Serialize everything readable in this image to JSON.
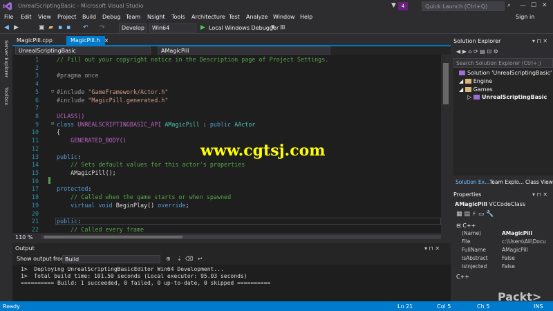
{
  "window": {
    "title": "UnrealScriptingBasic - Microsoft Visual Studio",
    "notification_count": "4",
    "quick_launch_placeholder": "Quick Launch (Ctrl+Q)",
    "sign_in": "Sign in"
  },
  "menu": [
    "File",
    "Edit",
    "View",
    "Project",
    "Build",
    "Debug",
    "Team",
    "Nsight",
    "Tools",
    "Architecture",
    "Test",
    "Analyze",
    "Window",
    "Help"
  ],
  "toolbar": {
    "config": "Develop",
    "platform": "Win64",
    "debugger": "Local Windows Debugger"
  },
  "side_tabs": [
    "Server Explorer",
    "Toolbox"
  ],
  "tabs": [
    {
      "label": "MagicPill.cpp"
    },
    {
      "label": "MagicPill.h",
      "close": "×"
    }
  ],
  "nav": {
    "project": "UnrealScriptingBasic",
    "symbol": "AMagicPill"
  },
  "editor": {
    "line_numbers": [
      "1",
      "2",
      "3",
      "4",
      "5",
      "6",
      "7",
      "8",
      "9",
      "10",
      "11",
      "12",
      "13",
      "14",
      "15",
      "16",
      "17",
      "18",
      "19",
      "20",
      "21",
      "22"
    ],
    "lines": {
      "l1": "// Fill out your copyright notice in the Description page of Project Settings.",
      "l3": "#pragma once",
      "l5a": "#include ",
      "l5b": "\"GameFramework/Actor.h\"",
      "l6a": "#include ",
      "l6b": "\"MagicPill.generated.h\"",
      "l8": "UCLASS()",
      "l9a": "class ",
      "l9b": "UNREALSCRIPTINGBASIC_API ",
      "l9c": "AMagicPill ",
      "l9d": ": ",
      "l9e": "public ",
      "l9f": "AActor",
      "l10": "{",
      "l11": "    GENERATED_BODY()",
      "l13a": "public",
      "l13b": ":",
      "l14": "    // Sets default values for this actor's properties",
      "l15": "    AMagicPill();",
      "l17a": "protected",
      "l17b": ":",
      "l18": "    // Called when the game starts or when spawned",
      "l19a": "    virtual ",
      "l19b": "void ",
      "l19c": "BeginPlay() ",
      "l19d": "override",
      ";": ";",
      "l21a": "public",
      "l21b": ":",
      "l22": "    // Called every frame"
    }
  },
  "zoom": "110 %",
  "output": {
    "title": "Output",
    "show_from": "Show output from:",
    "source": "Build",
    "lines": [
      "1>  Deploying UnrealScriptingBasicEditor Win64 Development...",
      "1>  Total build time: 101.50 seconds (Local executor: 95.03 seconds)",
      "========== Build: 1 succeeded, 0 failed, 0 up-to-date, 0 skipped =========="
    ]
  },
  "watermark": "www.cgtsj.com",
  "solution_explorer": {
    "title": "Solution Explorer",
    "search_placeholder": "Search Solution Explorer (Ctrl+;)",
    "solution": "Solution 'UnrealScriptingBasic' (2 pr",
    "engine": "Engine",
    "games": "Games",
    "project": "UnrealScriptingBasic",
    "tabs": [
      "Solution Ex...",
      "Team Explo...",
      "Class View"
    ]
  },
  "properties": {
    "title": "Properties",
    "object": "AMagicPill",
    "object_type": "VCCodeClass",
    "category": "C++",
    "rows": [
      {
        "name": "(Name)",
        "value": "AMagicPill"
      },
      {
        "name": "File",
        "value": "c:\\Users\\Ali\\Docu"
      },
      {
        "name": "FullName",
        "value": "AMagicPill"
      },
      {
        "name": "IsAbstract",
        "value": "False"
      },
      {
        "name": "IsInjected",
        "value": "False"
      }
    ],
    "description": "C++"
  },
  "status": {
    "ready": "Ready",
    "ln": "Ln 21",
    "col": "Col 5",
    "ch": "Ch 5",
    "ins": "INS"
  },
  "brand": "Packt>"
}
